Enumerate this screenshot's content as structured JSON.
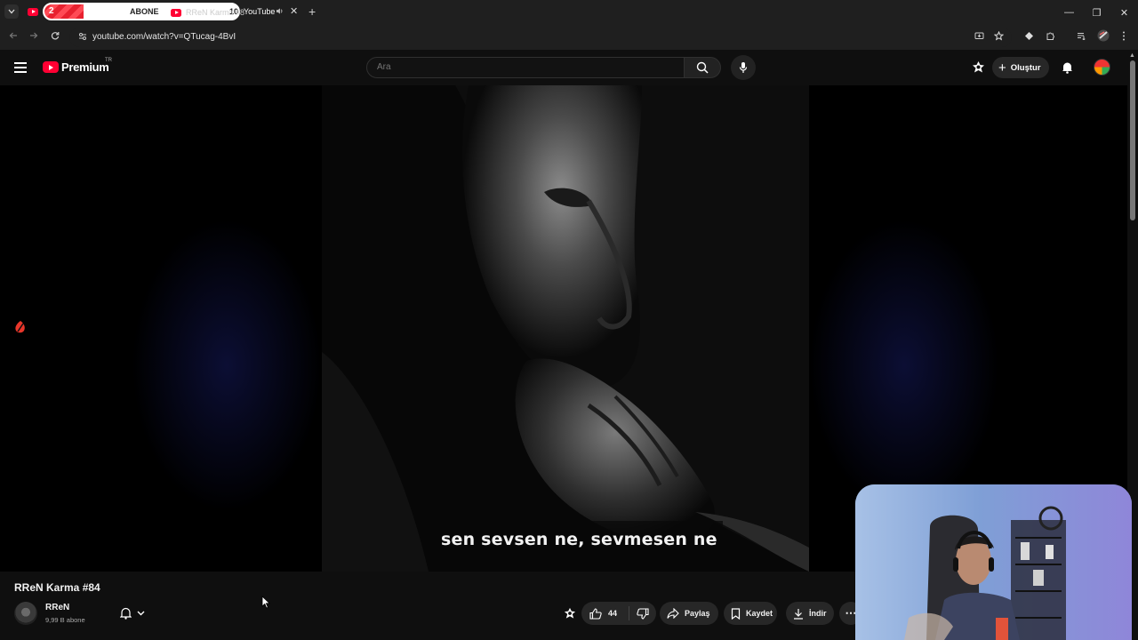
{
  "browser": {
    "overlay_tab": {
      "count": "2",
      "label": "ABONE",
      "number": "10",
      "progress": 0.2
    },
    "active_tab": {
      "title": "RReN Karma #8",
      "title_suffix": "YouTube",
      "audio_icon": "speaker-icon",
      "close": "✕"
    },
    "new_tab": "+",
    "window_controls": {
      "minimize": "—",
      "restore": "❐",
      "close": "✕"
    },
    "url": "youtube.com/watch?v=QTucag-4BvI"
  },
  "masthead": {
    "logo_text": "Premium",
    "region": "TR",
    "search_placeholder": "Ara",
    "create_label": "Oluştur",
    "create_plus": "+"
  },
  "player": {
    "caption": "sen sevsen ne, sevmesen ne"
  },
  "video": {
    "title": "RReN Karma #84",
    "channel": "RReN",
    "subscribers": "9,99 B abone",
    "likes": "44",
    "share_label": "Paylaş",
    "save_label": "Kaydet",
    "download_label": "İndir",
    "more": "⋯"
  },
  "colors": {
    "brand_red": "#ff0033",
    "background": "#0f0f0f",
    "pill": "#272727"
  }
}
